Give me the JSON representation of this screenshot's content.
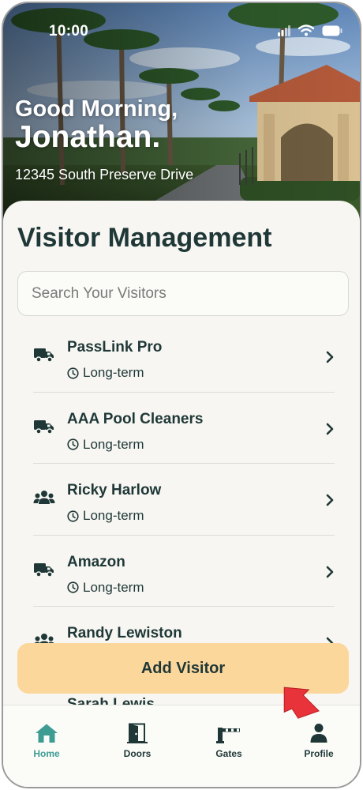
{
  "status_bar": {
    "time": "10:00",
    "icons": [
      "signal-icon",
      "wifi-icon",
      "battery-icon"
    ]
  },
  "header": {
    "greeting": "Good Morning,",
    "name": "Jonathan.",
    "address": "12345 South Preserve Drive"
  },
  "main": {
    "title": "Visitor Management",
    "search_placeholder": "Search Your Visitors",
    "visitors": [
      {
        "name": "PassLink Pro",
        "duration": "Long-term",
        "icon": "truck-icon"
      },
      {
        "name": "AAA Pool Cleaners",
        "duration": "Long-term",
        "icon": "truck-icon"
      },
      {
        "name": "Ricky Harlow",
        "duration": "Long-term",
        "icon": "group-icon"
      },
      {
        "name": "Amazon",
        "duration": "Long-term",
        "icon": "truck-icon"
      },
      {
        "name": "Randy Lewiston",
        "duration": "",
        "icon": "group-icon"
      },
      {
        "name": "Sarah Lewis",
        "duration": "",
        "icon": ""
      }
    ],
    "add_button": "Add Visitor"
  },
  "nav": {
    "tabs": [
      {
        "label": "Home",
        "icon": "home-icon",
        "active": true
      },
      {
        "label": "Doors",
        "icon": "door-icon",
        "active": false
      },
      {
        "label": "Gates",
        "icon": "gate-icon",
        "active": false
      },
      {
        "label": "Profile",
        "icon": "person-icon",
        "active": false
      }
    ]
  },
  "colors": {
    "primary_text": "#1f3837",
    "accent": "#3e9c93",
    "button": "#fcd79c",
    "background": "#f7f6f2",
    "pointer": "#e8333a"
  }
}
